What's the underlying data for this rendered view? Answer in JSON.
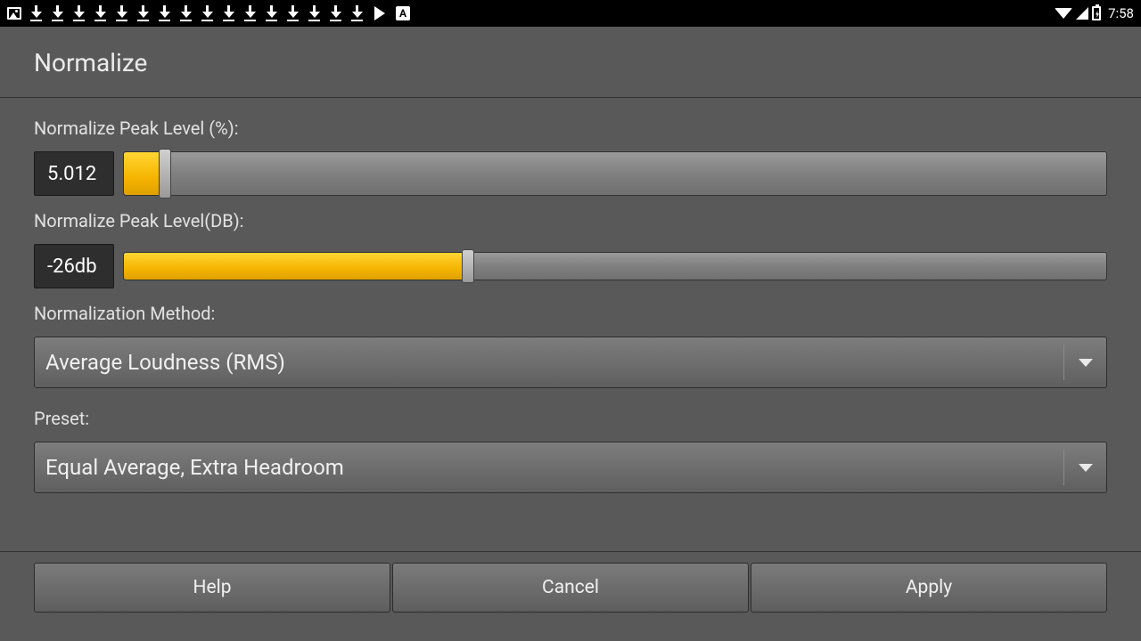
{
  "status": {
    "time": "7:58",
    "download_count": 16
  },
  "header": {
    "title": "Normalize"
  },
  "peak_percent": {
    "label": "Normalize Peak Level (%):",
    "value": "5.012",
    "fill_percent": 4.2
  },
  "peak_db": {
    "label": "Normalize Peak Level(DB):",
    "value": "-26db",
    "fill_percent": 35
  },
  "method": {
    "label": "Normalization Method:",
    "value": "Average Loudness (RMS)"
  },
  "preset": {
    "label": "Preset:",
    "value": "Equal Average, Extra Headroom"
  },
  "buttons": {
    "help": "Help",
    "cancel": "Cancel",
    "apply": "Apply"
  }
}
